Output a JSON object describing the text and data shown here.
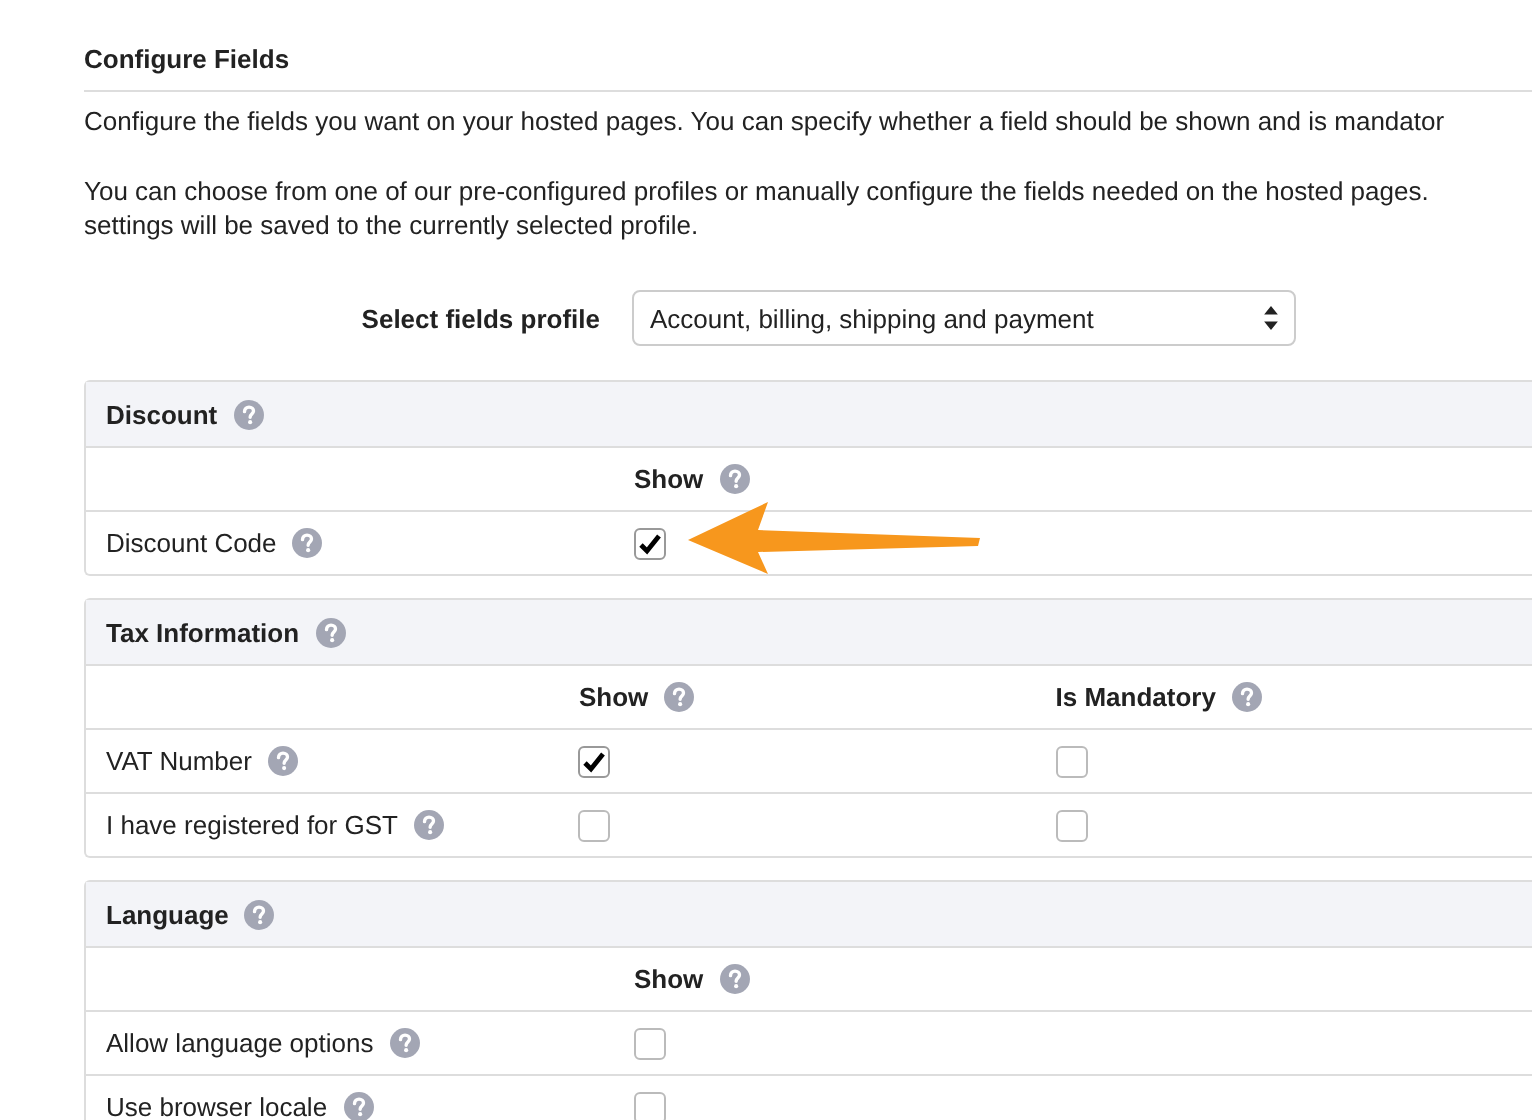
{
  "section": {
    "title": "Configure Fields"
  },
  "intro": [
    "Configure the fields you want on your hosted pages. You can specify whether a field should be shown and is mandator"
  ],
  "note_lines": [
    "You can choose from one of our pre-configured profiles or manually configure the fields needed on the hosted pages.",
    "settings will be saved to the currently selected profile."
  ],
  "profile": {
    "label": "Select fields profile",
    "value": "Account, billing, shipping and payment"
  },
  "groups": [
    {
      "title": "Discount",
      "columns": [
        "Show"
      ],
      "fields": [
        {
          "label": "Discount Code",
          "cells": [
            {
              "checked": true
            }
          ]
        }
      ]
    },
    {
      "title": "Tax Information",
      "columns": [
        "Show",
        "Is Mandatory"
      ],
      "fields": [
        {
          "label": "VAT Number",
          "cells": [
            {
              "checked": true
            },
            {
              "checked": false
            }
          ]
        },
        {
          "label": "I have registered for GST",
          "cells": [
            {
              "checked": false
            },
            {
              "checked": false
            }
          ]
        }
      ]
    },
    {
      "title": "Language",
      "columns": [
        "Show"
      ],
      "fields": [
        {
          "label": "Allow language options",
          "cells": [
            {
              "checked": false
            }
          ]
        },
        {
          "label": "Use browser locale",
          "cells": [
            {
              "checked": false
            }
          ]
        }
      ]
    }
  ]
}
